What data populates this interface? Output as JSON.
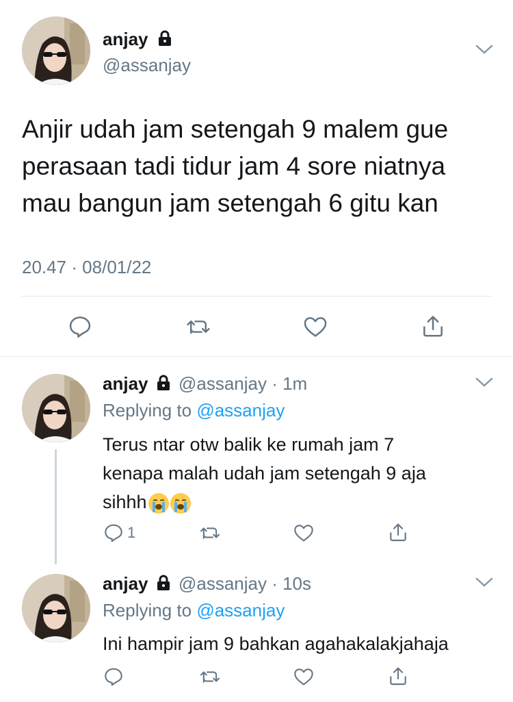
{
  "main_tweet": {
    "display_name": "anjay",
    "handle": "@assanjay",
    "text_lines": [
      "Anjir udah jam setengah 9 malem gue",
      "perasaan tadi tidur jam 4 sore niatnya",
      "mau bangun jam setengah 6 gitu kan"
    ],
    "timestamp": "20.47 · 08/01/22"
  },
  "replies": [
    {
      "display_name": "anjay",
      "handle": "@assanjay",
      "time": "· 1m",
      "replying_prefix": "Replying to",
      "replying_to": "@assanjay",
      "text_lines": [
        "Terus ntar otw balik ke rumah jam 7",
        "kenapa malah udah jam setengah 9 aja",
        "sihhh"
      ],
      "emojis": [
        "loudly-crying-face",
        "loudly-crying-face"
      ],
      "reply_count": "1"
    },
    {
      "display_name": "anjay",
      "handle": "@assanjay",
      "time": "· 10s",
      "replying_prefix": "Replying to",
      "replying_to": "@assanjay",
      "text_lines": [
        "Ini hampir jam 9 bahkan agahakalakjahaja"
      ],
      "reply_count": ""
    }
  ],
  "icons": {
    "lock": "lock-icon",
    "chevron": "chevron-down-icon",
    "reply": "reply-icon",
    "retweet": "retweet-icon",
    "like": "heart-icon",
    "share": "share-icon"
  },
  "colors": {
    "text": "#14171a",
    "muted": "#657786",
    "link": "#1da1f2",
    "divider": "#e1e8ed"
  }
}
